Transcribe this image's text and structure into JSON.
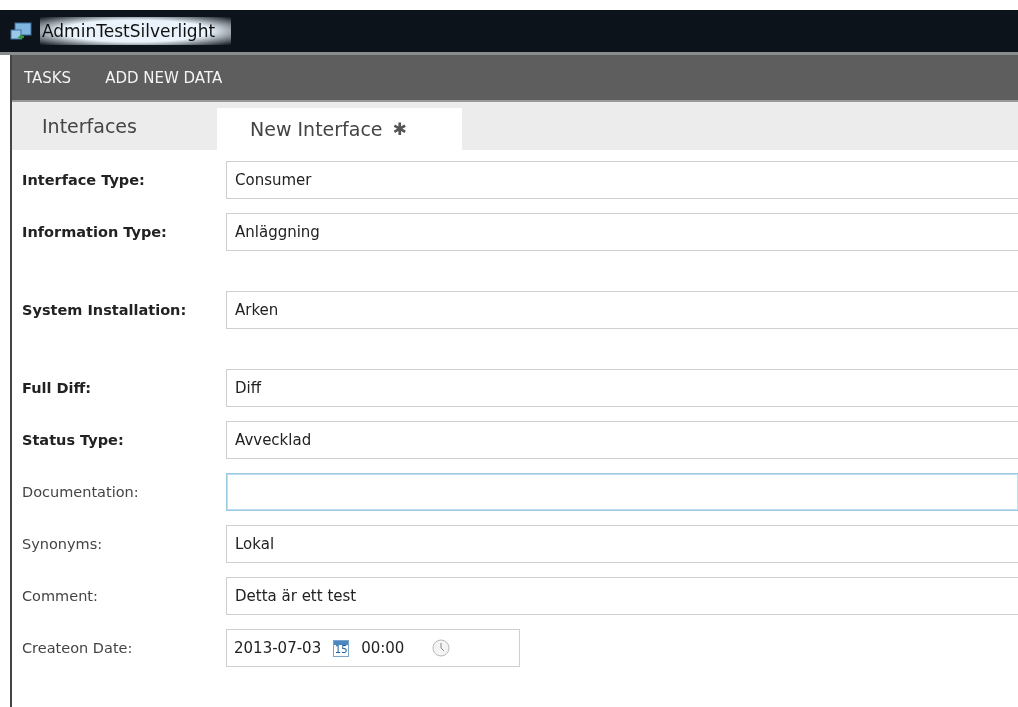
{
  "window": {
    "title": "AdminTestSilverlight"
  },
  "menu": [
    "TASKS",
    "ADD NEW DATA"
  ],
  "tabs": [
    {
      "label": "Interfaces",
      "selected": false
    },
    {
      "label": "New Interface",
      "selected": true,
      "modified_mark": "✱"
    }
  ],
  "sections": [
    {
      "fields": [
        {
          "kind": "text",
          "label": "Interface Type:",
          "required": true,
          "value": "Consumer",
          "focused": false
        },
        {
          "kind": "text",
          "label": "Information Type:",
          "required": true,
          "value": "Anläggning",
          "focused": false
        }
      ]
    },
    {
      "fields": [
        {
          "kind": "text",
          "label": "System Installation:",
          "required": true,
          "value": "Arken",
          "focused": false
        }
      ]
    },
    {
      "fields": [
        {
          "kind": "text",
          "label": "Full Diff:",
          "required": true,
          "value": "Diff",
          "focused": false
        },
        {
          "kind": "text",
          "label": "Status Type:",
          "required": true,
          "value": "Avvecklad",
          "focused": false
        },
        {
          "kind": "text",
          "label": "Documentation:",
          "required": false,
          "focused": true
        },
        {
          "kind": "text",
          "label": "Synonyms:",
          "required": false,
          "value": "Lokal",
          "focused": false
        },
        {
          "kind": "text",
          "label": "Comment:",
          "required": false,
          "value": "Detta är ett test",
          "focused": false
        },
        {
          "kind": "datetime",
          "label": "Createon Date:",
          "required": false,
          "date": "2013-07-03",
          "calendar_day": "15",
          "time": "00:00",
          "focused": false
        }
      ]
    }
  ]
}
